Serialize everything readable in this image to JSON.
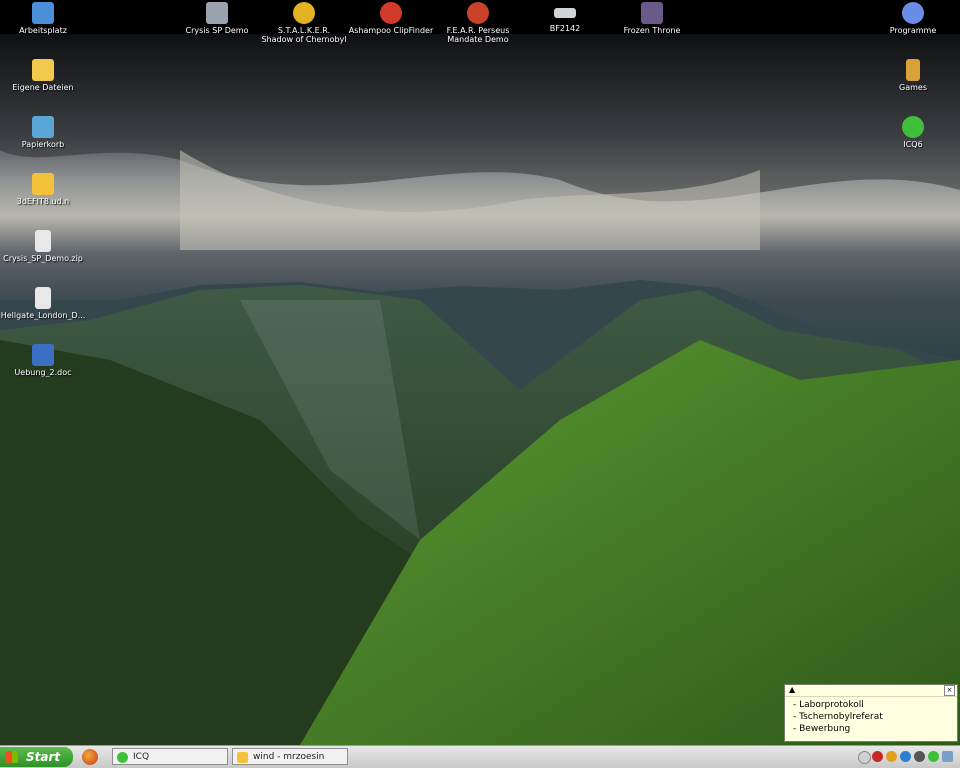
{
  "desktop_icons_left": [
    {
      "label": "Arbeitsplatz",
      "icon": "computer-icon",
      "color": "#4a8fd8"
    },
    {
      "label": "Eigene Dateien",
      "icon": "folder-documents-icon",
      "color": "#f2c94c"
    },
    {
      "label": "Papierkorb",
      "icon": "recycle-bin-icon",
      "color": "#5aa7d6"
    },
    {
      "label": "3dEFIT8.ud.n",
      "icon": "folder-icon",
      "color": "#f3c23a"
    },
    {
      "label": "Crysis_SP_Demo.zip",
      "icon": "zip-file-icon",
      "color": "#e8e8e8"
    },
    {
      "label": "Hellgate_London_D...",
      "icon": "zip-file-icon",
      "color": "#e8e8e8"
    },
    {
      "label": "Uebung_2.doc",
      "icon": "word-document-icon",
      "color": "#3a6fc4"
    }
  ],
  "desktop_icons_top": [
    {
      "label": "Crysis SP Demo",
      "label2": "",
      "icon": "crysis-icon",
      "color": "#9aa3ad"
    },
    {
      "label": "S.T.A.L.K.E.R.",
      "label2": "Shadow of Chernobyl",
      "icon": "radiation-icon",
      "color": "#e2b223"
    },
    {
      "label": "Ashampoo ClipFinder",
      "label2": "",
      "icon": "clipfinder-icon",
      "color": "#d23a2a"
    },
    {
      "label": "F.E.A.R. Perseus",
      "label2": "Mandate Demo",
      "icon": "fear-icon",
      "color": "#c8422a"
    },
    {
      "label": "BF2142",
      "label2": "",
      "icon": "bf2142-icon",
      "color": "#cfd4d8"
    },
    {
      "label": "Frozen Throne",
      "label2": "",
      "icon": "frozen-throne-icon",
      "color": "#6a5a8a"
    }
  ],
  "desktop_icons_right": [
    {
      "label": "Programme",
      "icon": "gear-icon",
      "color": "#6a8de8"
    },
    {
      "label": "Games",
      "icon": "gamepad-icon",
      "color": "#d9a13a"
    },
    {
      "label": "ICQ6",
      "icon": "icq-flower-icon",
      "color": "#3fbf3a"
    }
  ],
  "note": {
    "arrow": "▲",
    "close": "×",
    "items": [
      "- Laborprotokoll",
      "- Tschernobylreferat",
      "- Bewerbung"
    ]
  },
  "taskbar": {
    "start_label": "Start",
    "buttons": [
      {
        "label": "ICQ",
        "icon": "icq-flower-icon",
        "color": "#3fbf3a"
      },
      {
        "label": "wind - mrzoesin",
        "icon": "folder-icon",
        "color": "#f3c23a"
      }
    ]
  }
}
